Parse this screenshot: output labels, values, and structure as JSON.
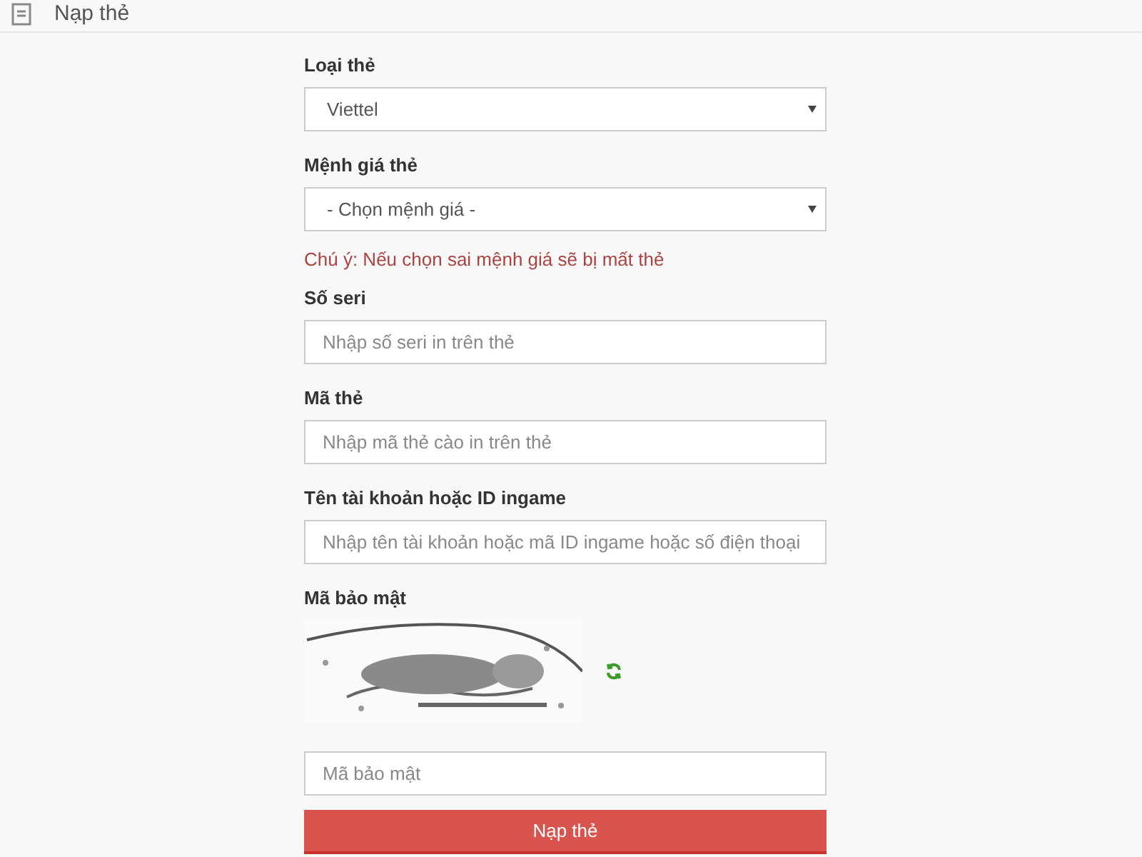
{
  "header": {
    "title": "Nạp thẻ"
  },
  "fields": [
    {
      "kind": "select",
      "label": "Loại thẻ",
      "value": "Viettel"
    },
    {
      "kind": "select",
      "label": "Mệnh giá thẻ",
      "value": "- Chọn mệnh giá -",
      "note": "Chú ý: Nếu chọn sai mệnh giá sẽ bị mất thẻ"
    },
    {
      "kind": "input",
      "label": "Số seri",
      "placeholder": "Nhập số seri in trên thẻ"
    },
    {
      "kind": "input",
      "label": "Mã thẻ",
      "placeholder": "Nhập mã thẻ cào in trên thẻ"
    },
    {
      "kind": "input",
      "label": "Tên tài khoản hoặc ID ingame",
      "placeholder": "Nhập tên tài khoản hoặc mã ID ingame hoặc số điện thoại"
    },
    {
      "kind": "captcha",
      "label": "Mã bảo mật"
    },
    {
      "kind": "input",
      "placeholder": "Mã bảo mật"
    }
  ],
  "submit": {
    "label": "Nạp thẻ"
  }
}
